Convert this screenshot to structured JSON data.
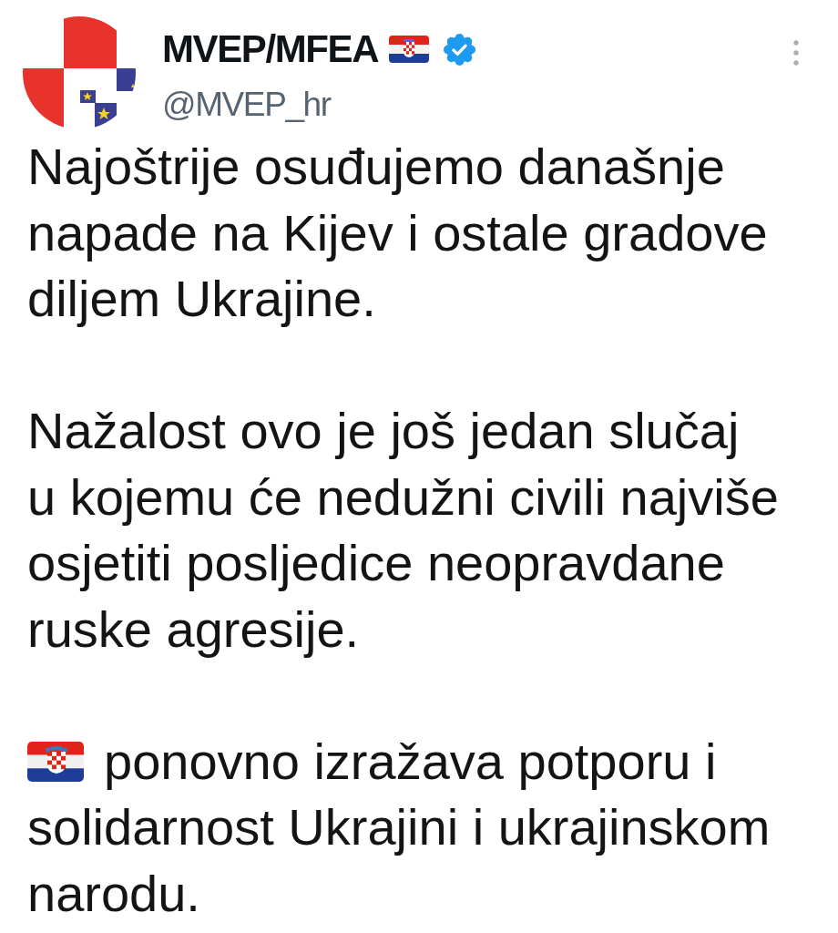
{
  "author": {
    "display_name": "MVEP/MFEA",
    "verified": true,
    "handle": "@MVEP_hr"
  },
  "paragraphs": [
    {
      "kind": "plain",
      "text": "Najoštrije osuđujemo današnje\nnapade na Kijev i ostale gradove\ndiljem Ukrajine."
    },
    {
      "kind": "plain",
      "text": "Nažalost ovo je još jedan slučaj\nu kojemu će nedužni civili najviše\nosjetiti posljedice neopravdane\nruske agresije."
    },
    {
      "kind": "flag_lead",
      "text": "ponovno izražava potporu i\nsolidarnost Ukrajini i ukrajinskom\nnarodu."
    }
  ]
}
